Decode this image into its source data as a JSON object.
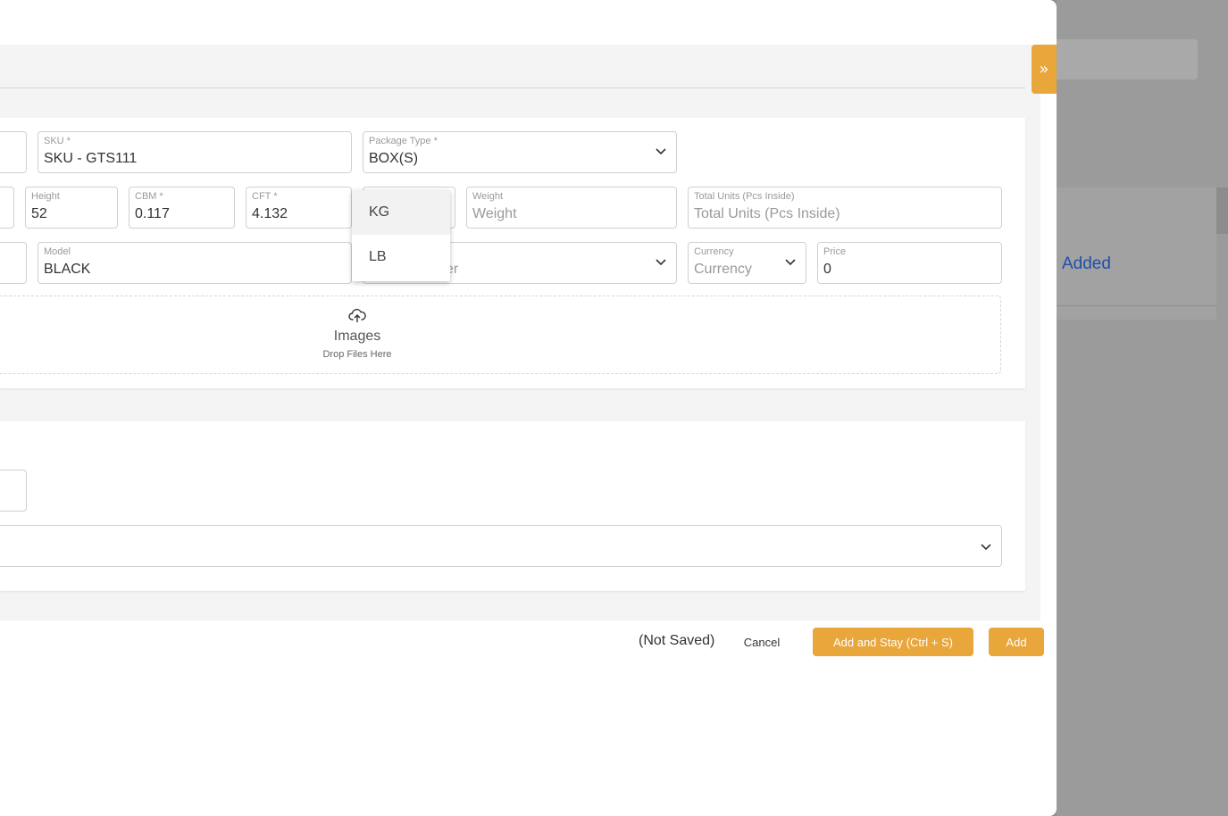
{
  "background": {
    "added_text": "Added"
  },
  "modal": {
    "collapse_glyph": "»",
    "row1": {
      "sku": {
        "label": "SKU *",
        "value": "SKU - GTS111"
      },
      "package_type": {
        "label": "Package Type *",
        "value": "BOX(S)"
      }
    },
    "row2": {
      "height": {
        "label": "Height",
        "value": "52"
      },
      "cbm": {
        "label": "CBM *",
        "value": "0.117"
      },
      "cft": {
        "label": "CFT *",
        "value": "4.132"
      },
      "weight": {
        "label": "Weight",
        "placeholder": "Weight"
      },
      "total_units": {
        "label": "Total Units (Pcs Inside)",
        "placeholder": "Total Units (Pcs Inside)"
      }
    },
    "row3": {
      "model": {
        "label": "Model",
        "value": "BLACK"
      },
      "partial_placeholder": "er",
      "currency": {
        "label": "Currency",
        "placeholder": "Currency"
      },
      "price": {
        "label": "Price",
        "value": "0"
      }
    },
    "dropzone": {
      "title": "Images",
      "subtitle": "Drop Files Here",
      "icon": "cloud-upload-icon"
    },
    "weight_unit_dropdown": {
      "options": [
        "KG",
        "LB"
      ],
      "highlighted": "KG"
    },
    "footer": {
      "status": "(Not Saved)",
      "cancel": "Cancel",
      "add_and_stay": "Add and Stay (Ctrl + S)",
      "add": "Add"
    }
  },
  "colors": {
    "accent": "#e8a63b",
    "link_blue": "#1f4fa8"
  }
}
